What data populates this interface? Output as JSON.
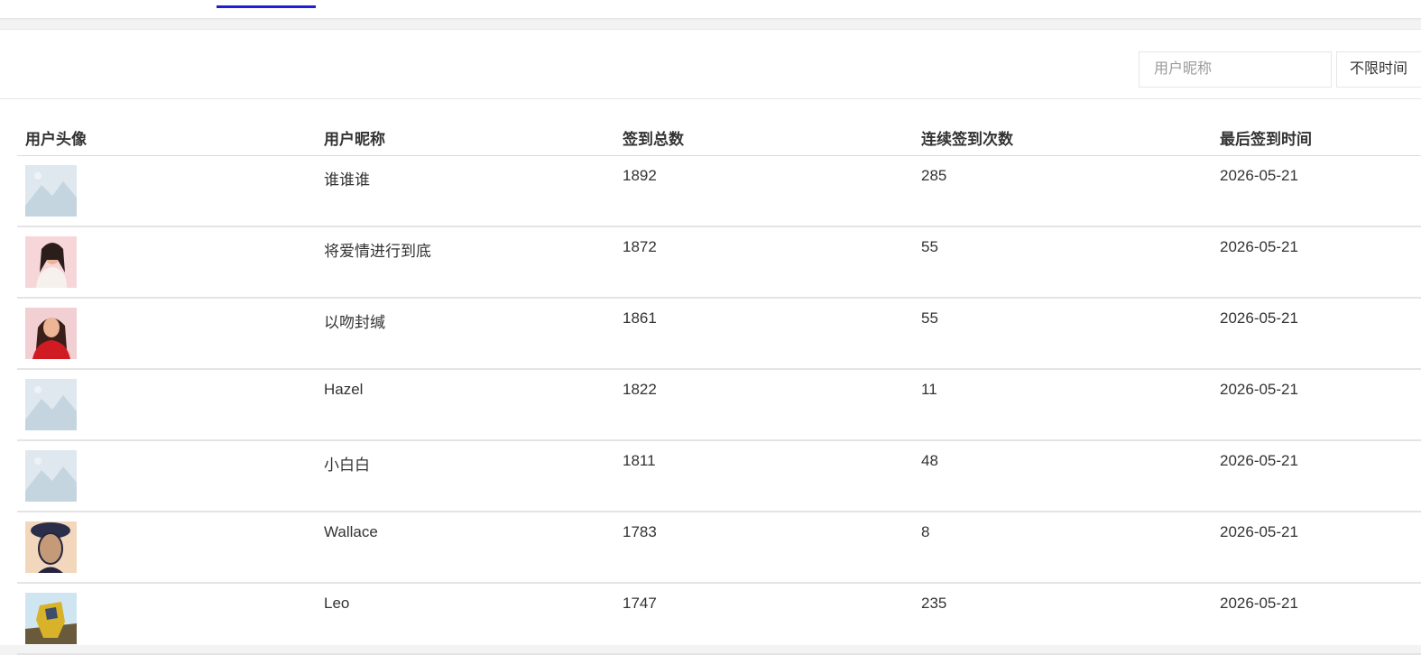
{
  "filters": {
    "nickname_placeholder": "用户昵称",
    "time_select_value": "不限时间"
  },
  "table": {
    "columns": [
      "用户头像",
      "用户昵称",
      "签到总数",
      "连续签到次数",
      "最后签到时间"
    ],
    "rows": [
      {
        "avatar": "placeholder-image-icon",
        "nickname": "谁谁谁",
        "total": "1892",
        "streak": "285",
        "last": "2026-05-21"
      },
      {
        "avatar": "user-photo",
        "nickname": "将爱情进行到底",
        "total": "1872",
        "streak": "55",
        "last": "2026-05-21"
      },
      {
        "avatar": "user-photo",
        "nickname": "以吻封缄",
        "total": "1861",
        "streak": "55",
        "last": "2026-05-21"
      },
      {
        "avatar": "placeholder-image-icon",
        "nickname": "Hazel",
        "total": "1822",
        "streak": "11",
        "last": "2026-05-21"
      },
      {
        "avatar": "placeholder-image-icon",
        "nickname": "小白白",
        "total": "1811",
        "streak": "48",
        "last": "2026-05-21"
      },
      {
        "avatar": "user-photo",
        "nickname": "Wallace",
        "total": "1783",
        "streak": "8",
        "last": "2026-05-21"
      },
      {
        "avatar": "user-photo",
        "nickname": "Leo",
        "total": "1747",
        "streak": "235",
        "last": "2026-05-21"
      }
    ]
  },
  "colors": {
    "tab_active": "#1f1fd6",
    "border": "#e4e4e4",
    "placeholder_bg": "#dfe8ef"
  }
}
